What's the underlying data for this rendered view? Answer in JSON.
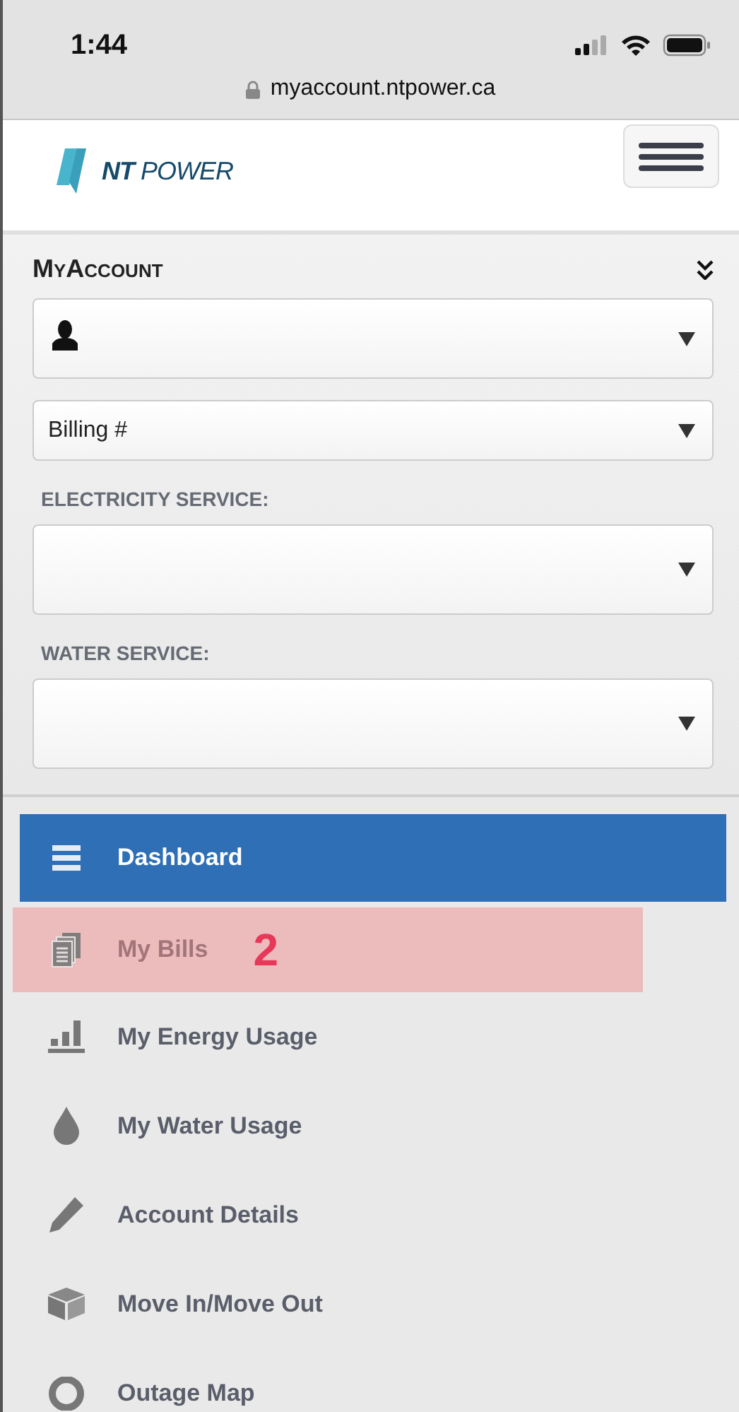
{
  "status_bar": {
    "time": "1:44",
    "url": "myaccount.ntpower.ca"
  },
  "header": {
    "logo": {
      "bold": "NT",
      "rest": "POWER"
    }
  },
  "account_panel": {
    "title": "MyAccount",
    "selects": [
      {
        "kind": "user"
      },
      {
        "kind": "text",
        "value": "Billing #"
      }
    ],
    "services": [
      {
        "label": "ELECTRICITY SERVICE:"
      },
      {
        "label": "WATER SERVICE:"
      }
    ]
  },
  "menu": [
    {
      "label": "Dashboard",
      "kind": "list",
      "selected": true,
      "highlighted": false
    },
    {
      "label": "My Bills",
      "kind": "bills",
      "selected": false,
      "highlighted": true,
      "annotation": "2"
    },
    {
      "label": "My Energy Usage",
      "kind": "chart",
      "selected": false,
      "highlighted": false
    },
    {
      "label": "My Water Usage",
      "kind": "drop",
      "selected": false,
      "highlighted": false
    },
    {
      "label": "Account Details",
      "kind": "pencil",
      "selected": false,
      "highlighted": false
    },
    {
      "label": "Move In/Move Out",
      "kind": "box",
      "selected": false,
      "highlighted": false
    },
    {
      "label": "Outage Map",
      "kind": "pin",
      "selected": false,
      "highlighted": false
    }
  ]
}
